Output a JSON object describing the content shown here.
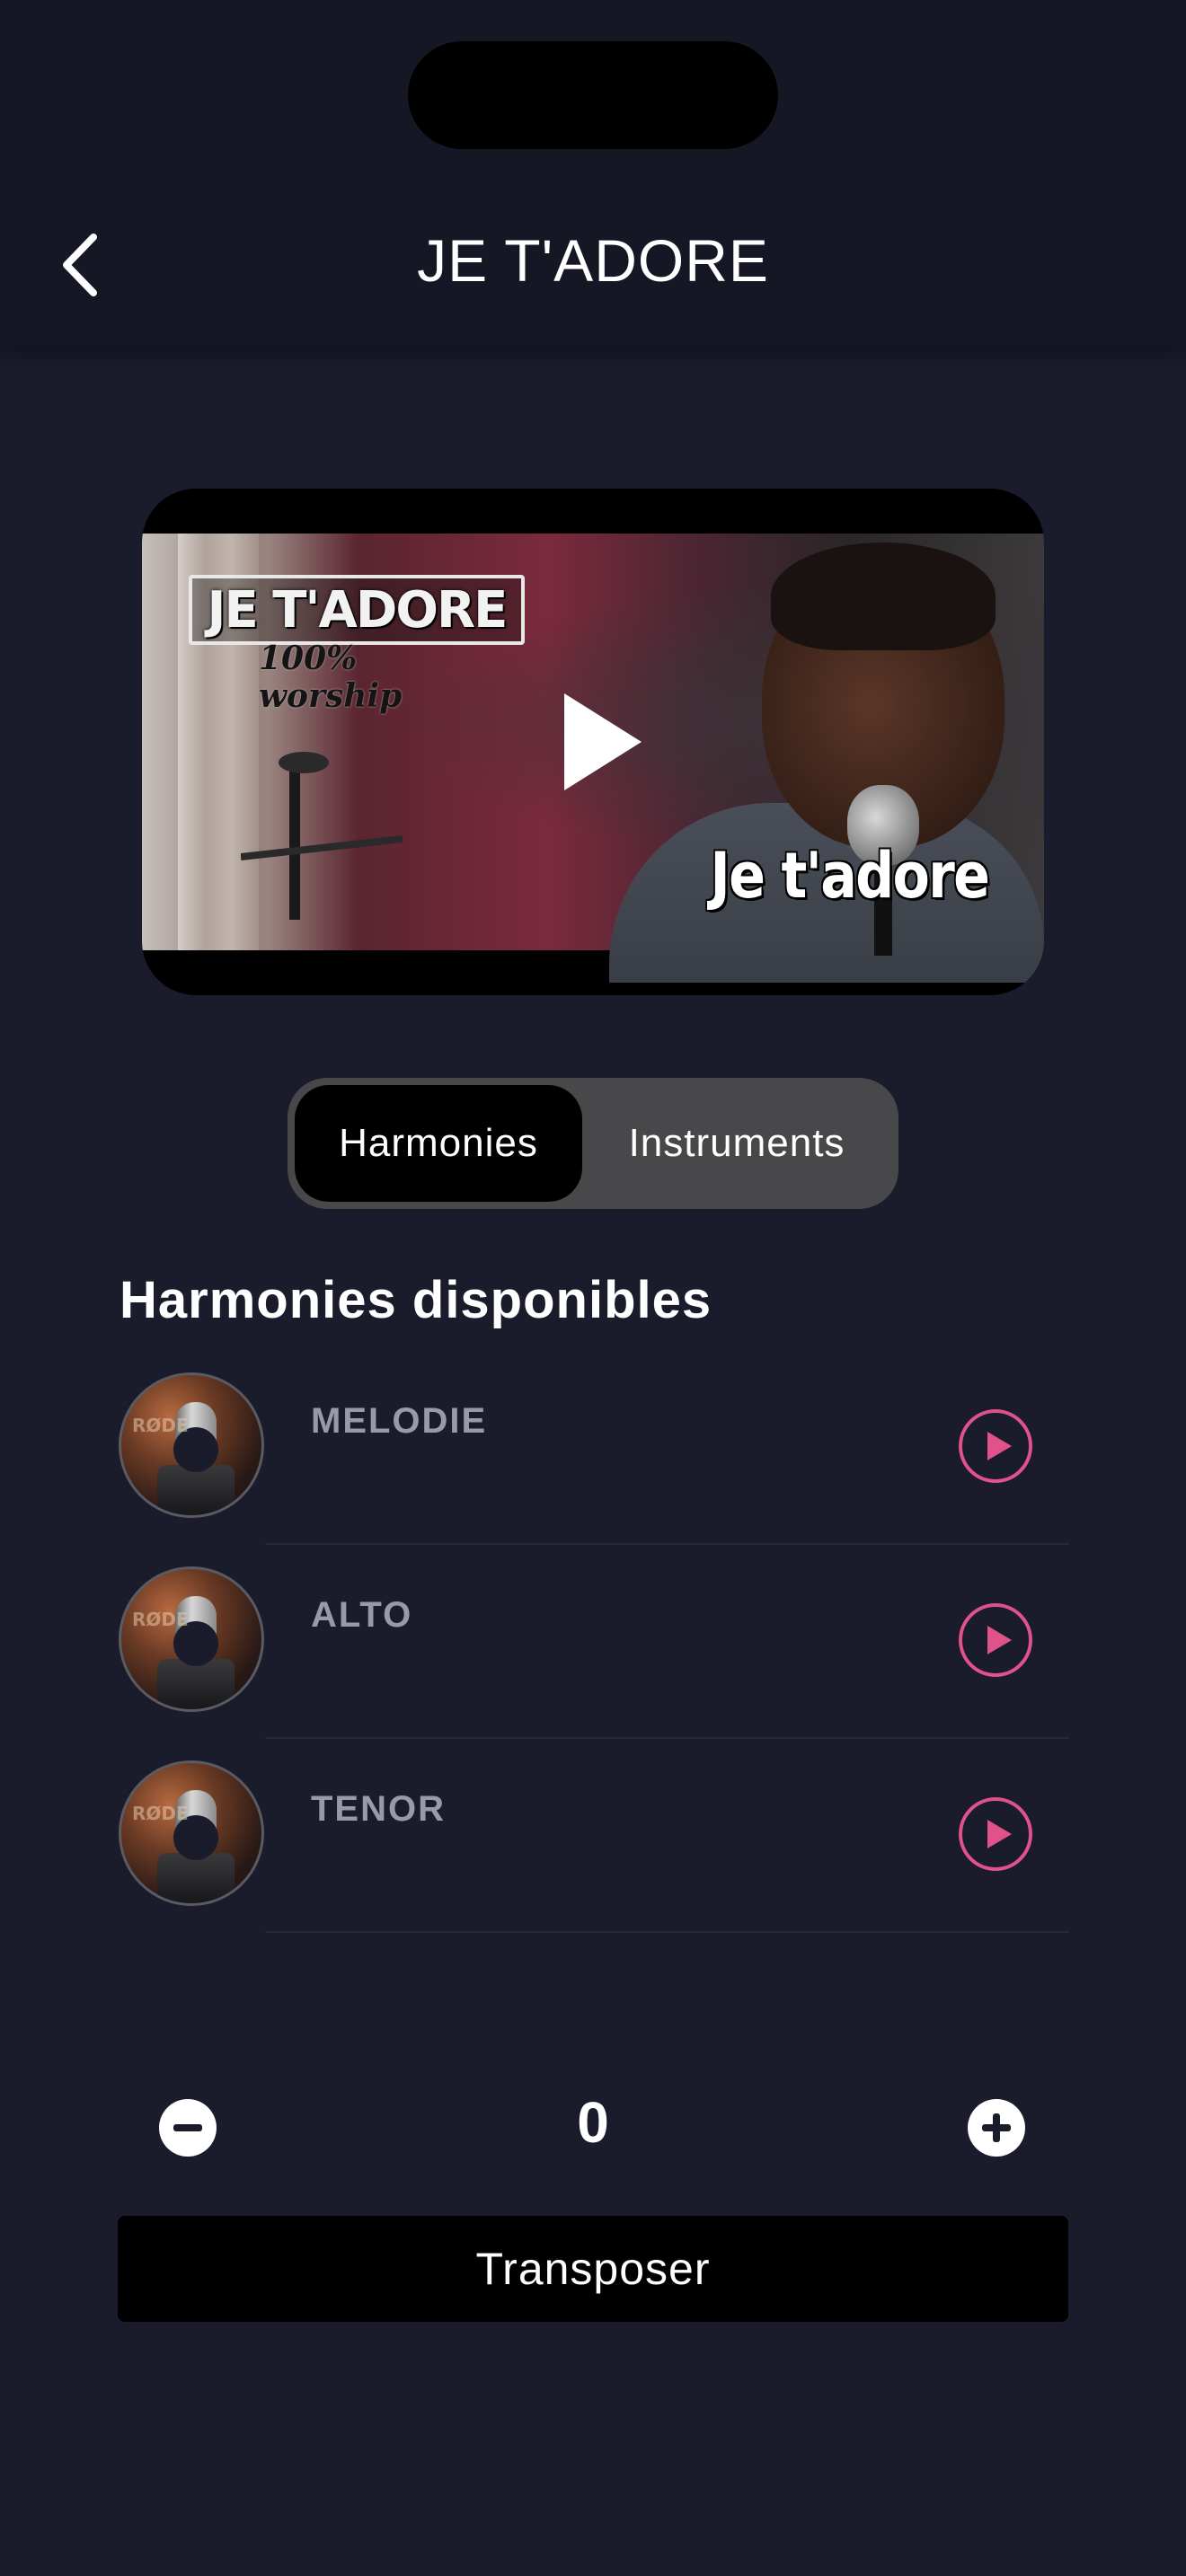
{
  "header": {
    "title": "JE T'ADORE",
    "back_icon": "chevron-left-icon"
  },
  "video": {
    "logo_text": "JE T'ADORE",
    "logo_subtext": "100% worship",
    "caption": "Je t'adore",
    "play_icon": "play-icon"
  },
  "tabs": [
    {
      "label": "Harmonies",
      "active": true
    },
    {
      "label": "Instruments",
      "active": false
    }
  ],
  "section": {
    "title": "Harmonies disponibles"
  },
  "harmonies": [
    {
      "label": "MELODIE",
      "avatar_text": "RØDE",
      "icon": "play-circle-icon"
    },
    {
      "label": "ALTO",
      "avatar_text": "RØDE",
      "icon": "play-circle-icon"
    },
    {
      "label": "TENOR",
      "avatar_text": "RØDE",
      "icon": "play-circle-icon"
    }
  ],
  "transpose": {
    "value": "0",
    "minus_icon": "minus-circle-icon",
    "plus_icon": "plus-circle-icon",
    "button_label": "Transposer"
  },
  "colors": {
    "background": "#1a1b2b",
    "accent_pink": "#e0528a",
    "muted_label": "#9a9aa6"
  }
}
